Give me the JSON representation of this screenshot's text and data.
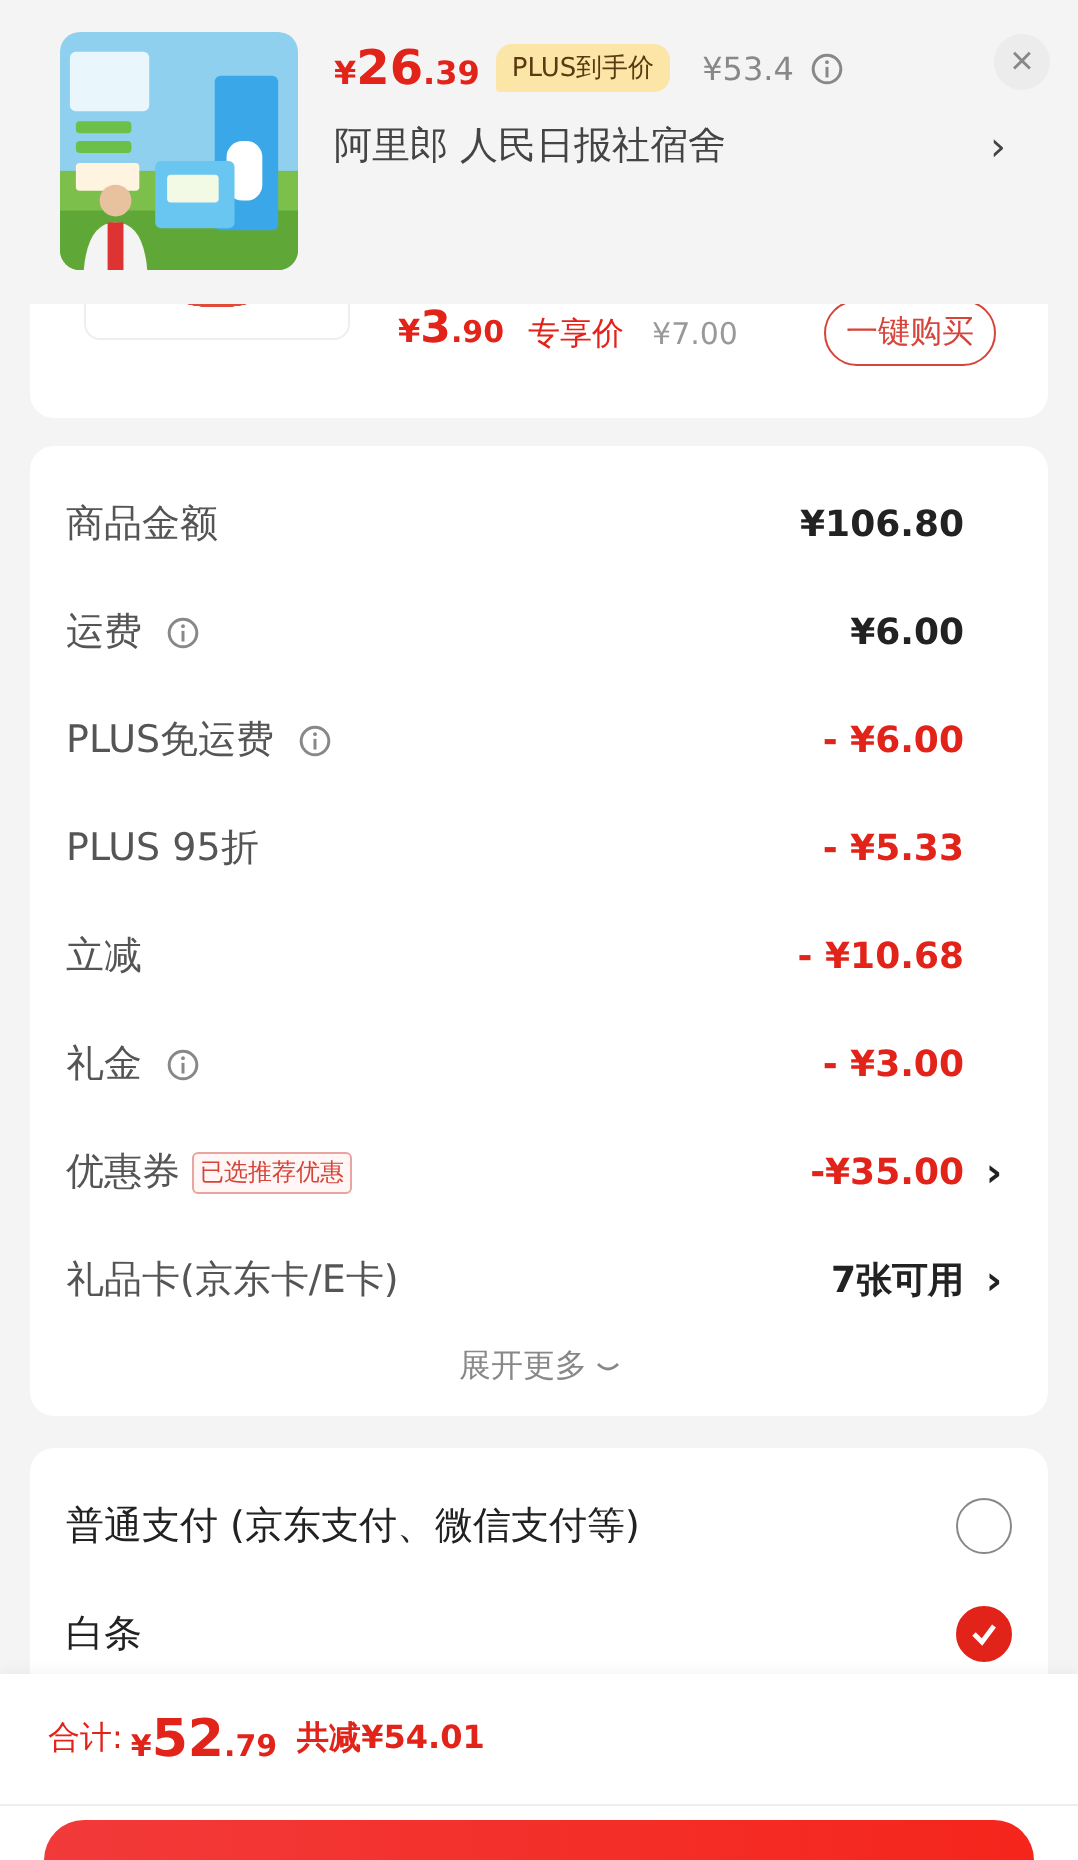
{
  "product_header": {
    "price_symbol": "¥",
    "price_int": "26",
    "price_dec": ".39",
    "price_tag": "PLUS到手价",
    "original_price": "¥53.4",
    "address": "阿里郎  人民日报社宿舍",
    "close": "×",
    "chevron": "›"
  },
  "addon_item": {
    "price_symbol": "¥",
    "price_int": "3",
    "price_dec": ".90",
    "price_label": "专享价",
    "original_price": "¥7.00",
    "button": "一键购买"
  },
  "fees": [
    {
      "label": "商品金额",
      "info": false,
      "kind": "normal",
      "value": "¥106.80"
    },
    {
      "label": "运费",
      "info": true,
      "kind": "normal",
      "value": "¥6.00"
    },
    {
      "label": "PLUS免运费",
      "info": true,
      "kind": "discount",
      "value": "- ¥6.00"
    },
    {
      "label": "PLUS 95折",
      "info": false,
      "kind": "discount",
      "value": "- ¥5.33"
    },
    {
      "label": "立减",
      "info": false,
      "kind": "discount",
      "value": "- ¥10.68"
    },
    {
      "label": "礼金",
      "info": true,
      "kind": "discount",
      "value": "- ¥3.00"
    },
    {
      "label": "优惠券",
      "info": false,
      "tag": "已选推荐优惠",
      "kind": "discount",
      "value": "-¥35.00",
      "chevron": "›"
    },
    {
      "label": "礼品卡(京东卡/E卡)",
      "info": false,
      "kind": "normal",
      "value": "7张可用",
      "chevron": "›"
    }
  ],
  "expand_more": "展开更多",
  "payment_options": [
    {
      "label": "普通支付 (京东支付、微信支付等)",
      "selected": false
    },
    {
      "label": "白条",
      "selected": true
    }
  ],
  "footer": {
    "total_label": "合计:",
    "total_symbol": "¥",
    "total_int": "52",
    "total_dec": ".79",
    "saved": "共减¥54.01"
  }
}
